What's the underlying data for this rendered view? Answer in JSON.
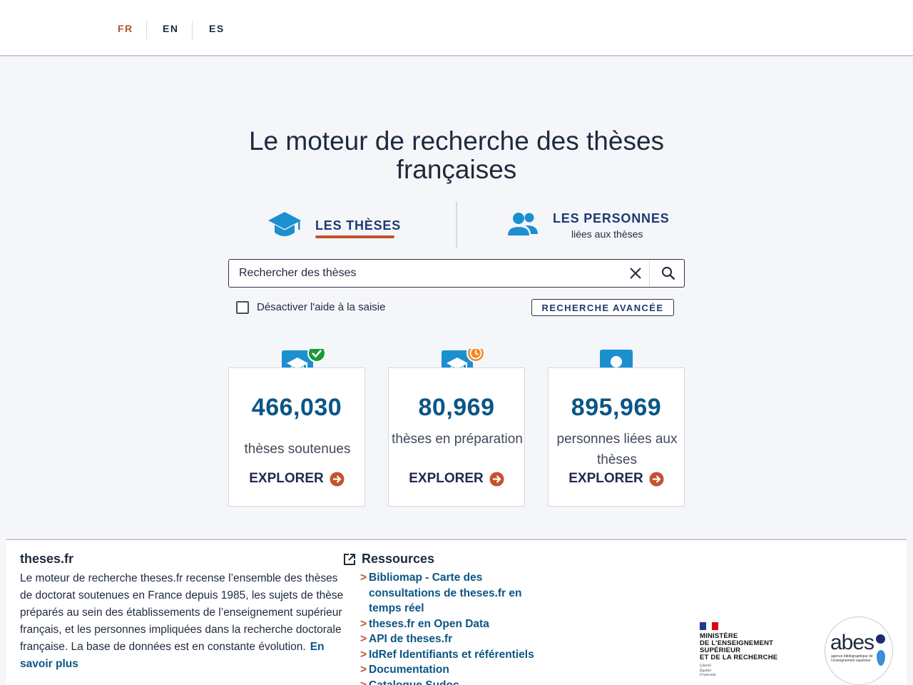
{
  "languages": [
    {
      "code": "FR",
      "active": true
    },
    {
      "code": "EN",
      "active": false
    },
    {
      "code": "ES",
      "active": false
    }
  ],
  "hero": {
    "title_line1": "Le moteur de recherche des thèses",
    "title_line2": "françaises"
  },
  "tabs": {
    "theses": {
      "label": "LES THÈSES",
      "icon": "graduation-cap-icon",
      "active": true
    },
    "personnes": {
      "label": "LES PERSONNES",
      "sublabel": "liées aux thèses",
      "icon": "people-icon"
    }
  },
  "search": {
    "placeholder": "Rechercher des thèses",
    "value": ""
  },
  "options": {
    "disable_autocomplete_label": "Désactiver l'aide à la saisie",
    "disable_autocomplete_checked": false,
    "advanced_search_label": "RECHERCHE AVANCÉE"
  },
  "stats": [
    {
      "number": "466,030",
      "label": "thèses soutenues",
      "explore": "EXPLORER",
      "icon": "thesis-defended-icon"
    },
    {
      "number": "80,969",
      "label": "thèses en préparation",
      "explore": "EXPLORER",
      "icon": "thesis-in-progress-icon"
    },
    {
      "number": "895,969",
      "label": "personnes liées aux thèses",
      "explore": "EXPLORER",
      "icon": "person-icon"
    }
  ],
  "footer": {
    "title": "theses.fr",
    "description": "Le moteur de recherche theses.fr recense l’ensemble des thèses de doctorat soutenues en France depuis 1985, les sujets de thèse préparés au sein des établissements de l’enseignement supérieur français, et les personnes impliquées dans la recherche doctorale française. La base de données est en constante évolution.",
    "more_link": "En savoir plus",
    "resources_title": "Ressources",
    "resources": [
      "Bibliomap - Carte des consultations de theses.fr en temps réel",
      "theses.fr en Open Data",
      "API de theses.fr",
      "IdRef Identifiants et référentiels",
      "Documentation",
      "Catalogue Sudoc"
    ],
    "ministry": {
      "line1": "MINISTÈRE",
      "line2": "DE L’ENSEIGNEMENT",
      "line3": "SUPÉRIEUR",
      "line4": "ET DE LA RECHERCHE",
      "motto1": "Liberté",
      "motto2": "Égalité",
      "motto3": "Fraternité"
    },
    "abes": {
      "wordmark": "abes",
      "subtitle": "agence bibliographique de l’enseignement supérieur"
    }
  },
  "colors": {
    "accent": "#c2532e",
    "primary": "#0b5587",
    "icon_blue": "#1b8fd0",
    "check_green": "#1a9a3a",
    "clock_orange": "#f08a24"
  }
}
